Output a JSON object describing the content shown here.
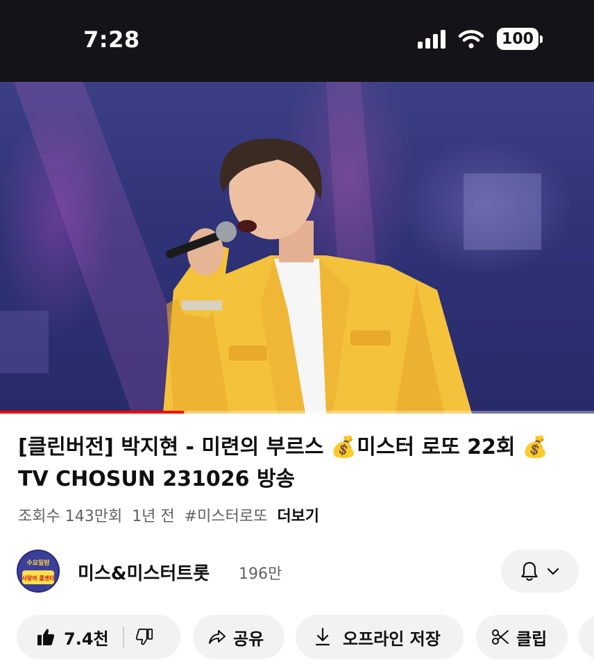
{
  "status": {
    "time": "7:28",
    "battery": "100"
  },
  "video": {
    "progress_fraction": 0.31
  },
  "title": "[클린버전] 박지현 - 미련의 부르스 💰미스터 로또 22회 💰 TV CHOSUN 231026 방송",
  "meta": {
    "views": "조회수 143만회",
    "age": "1년 전",
    "hashtag": "#미스터로또",
    "more": "더보기"
  },
  "channel": {
    "name": "미스&미스터트롯",
    "subscribers": "196만",
    "avatar_text_top": "수요일밤",
    "avatar_text_bottom": "사랑의 콜센타"
  },
  "actions": {
    "likes": "7.4천",
    "share": "공유",
    "download": "오프라인 저장",
    "clip": "클립"
  },
  "icons": {
    "like": "thumb-up-icon",
    "dislike": "thumb-down-icon",
    "share": "share-arrow-icon",
    "download": "download-icon",
    "clip": "scissors-icon",
    "bell": "bell-icon",
    "chevron": "chevron-down-icon"
  },
  "colors": {
    "progress": "#ff0000",
    "jacket": "#f5c23c"
  }
}
